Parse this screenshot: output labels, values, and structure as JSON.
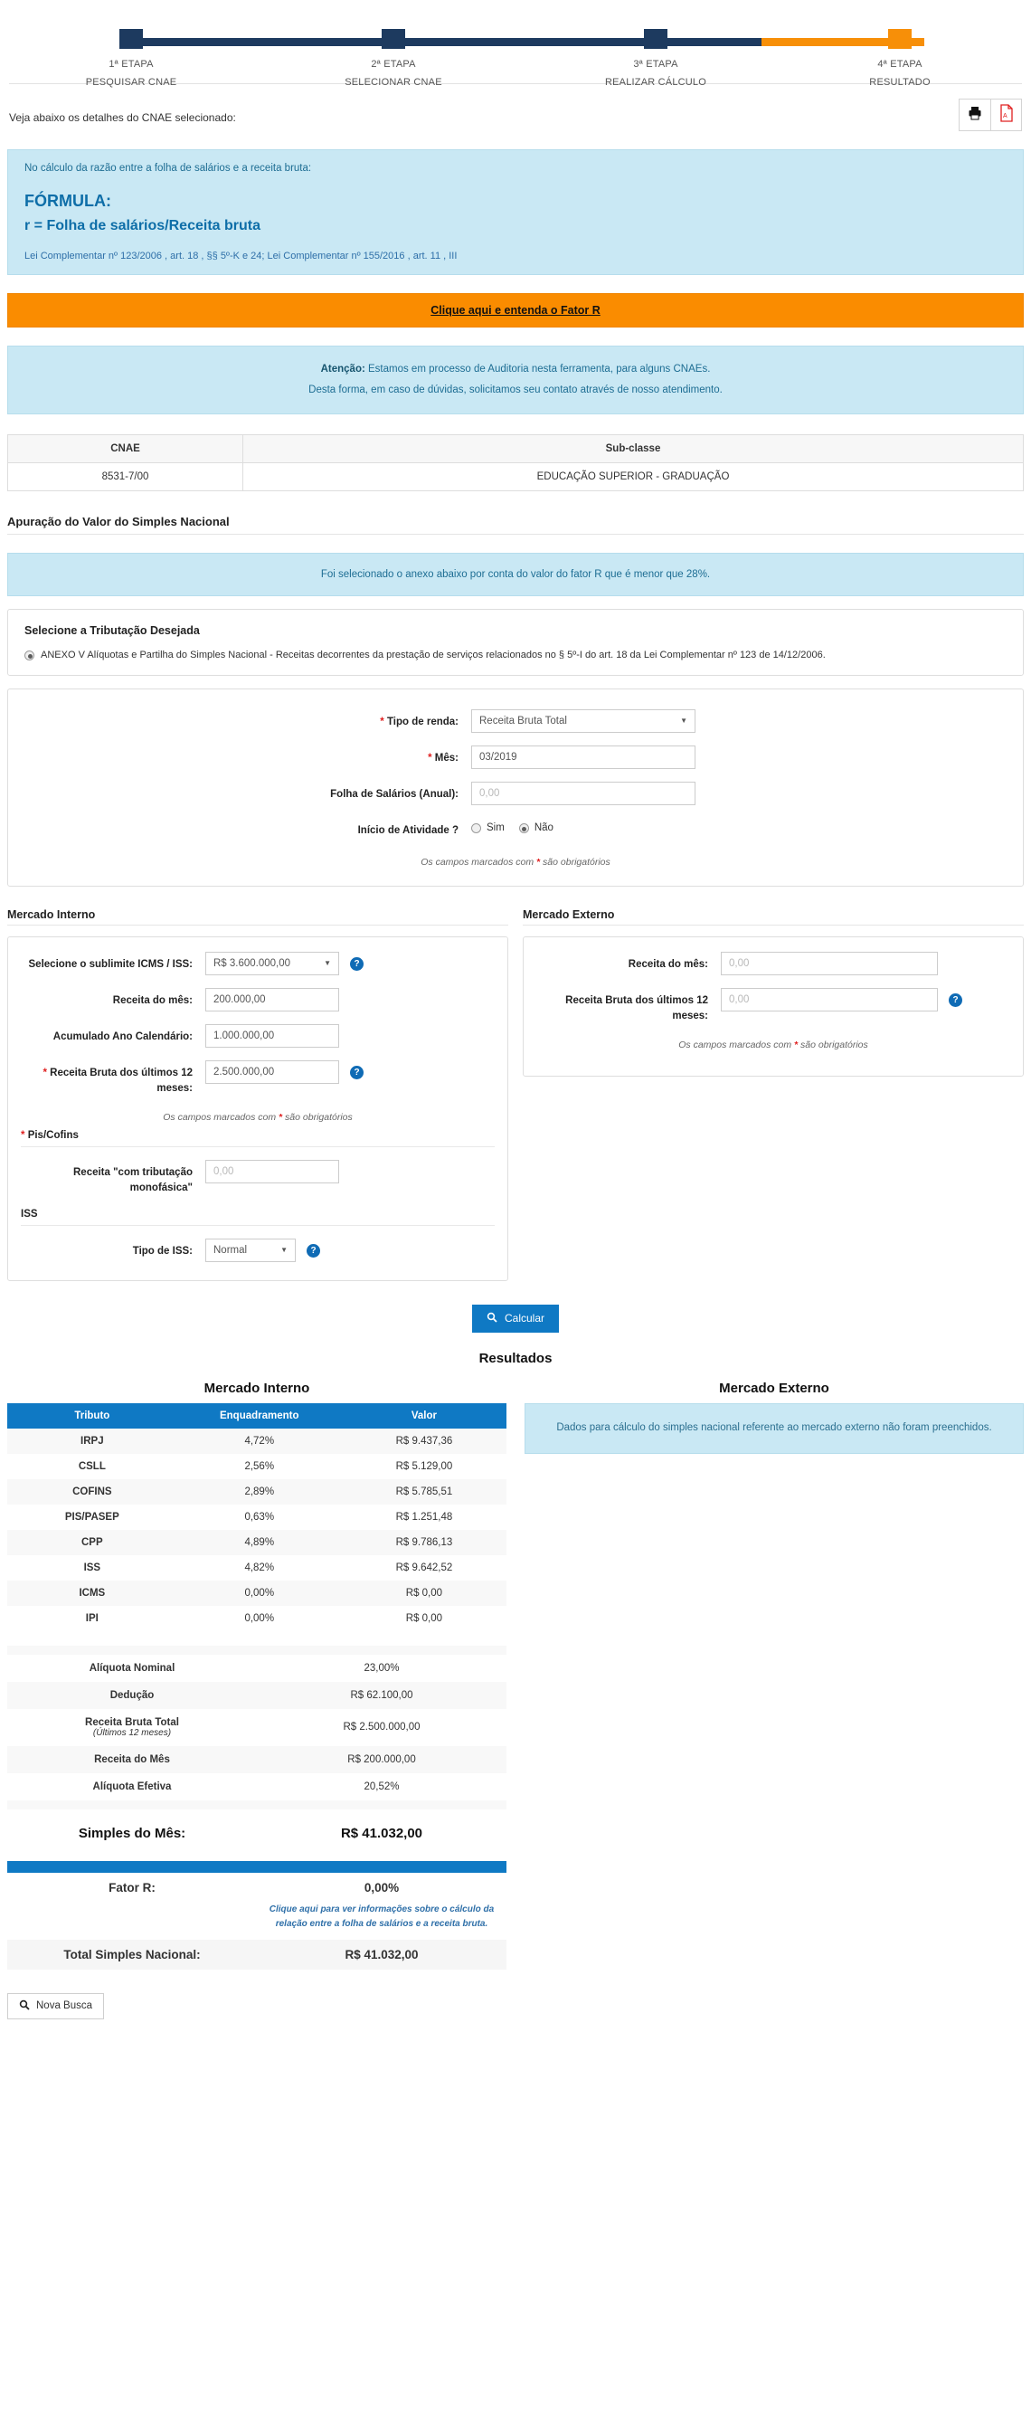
{
  "stepper": {
    "steps": [
      {
        "top": "1ª ETAPA",
        "bottom": "PESQUISAR CNAE"
      },
      {
        "top": "2ª ETAPA",
        "bottom": "SELECIONAR CNAE"
      },
      {
        "top": "3ª ETAPA",
        "bottom": "REALIZAR CÁLCULO"
      },
      {
        "top": "4ª ETAPA",
        "bottom": "RESULTADO"
      }
    ]
  },
  "topbar": {
    "lead": "Veja abaixo os detalhes do CNAE selecionado:",
    "print_icon": "printer-icon",
    "pdf_icon": "pdf-icon"
  },
  "formula_panel": {
    "intro": "No cálculo da razão entre a folha de salários e a receita bruta:",
    "title": "FÓRMULA:",
    "formula": "r = Folha de salários/Receita bruta",
    "law": "Lei Complementar nº 123/2006 , art. 18 , §§ 5º-K e 24; Lei Complementar nº 155/2016 , art. 11 , III"
  },
  "cta": {
    "label": "Clique aqui e entenda o Fator R"
  },
  "attention": {
    "prefix": "Atenção:",
    "line1": " Estamos em processo de Auditoria nesta ferramenta, para alguns CNAEs.",
    "line2": "Desta forma, em caso de dúvidas, solicitamos seu contato através de nosso atendimento."
  },
  "cnae_table": {
    "headers": [
      "CNAE",
      "Sub-classe"
    ],
    "row": {
      "cnae": "8531-7/00",
      "subclass": "EDUCAÇÃO SUPERIOR - GRADUAÇÃO"
    }
  },
  "apuracao": {
    "title": "Apuração do Valor do Simples Nacional",
    "notice": "Foi selecionado o anexo abaixo por conta do valor do fator R que é menor que 28%."
  },
  "tributacao": {
    "title": "Selecione a Tributação Desejada",
    "option": "ANEXO V Alíquotas e Partilha do Simples Nacional - Receitas decorrentes da prestação de serviços relacionados no § 5º-I do art. 18 da Lei Complementar nº 123 de 14/12/2006."
  },
  "main_form": {
    "tipo_renda_label": "Tipo de renda:",
    "tipo_renda_value": "Receita Bruta Total",
    "mes_label": "Mês:",
    "mes_value": "03/2019",
    "folha_label": "Folha de Salários (Anual):",
    "folha_placeholder": "0,00",
    "folha_value": "",
    "inicio_label": "Início de Atividade ?",
    "inicio_sim": "Sim",
    "inicio_nao": "Não",
    "inicio_selected": "Não",
    "required_note_pre": "Os campos marcados com ",
    "required_note_post": " são obrigatórios"
  },
  "mercado_interno": {
    "title": "Mercado Interno",
    "sublimite_label": "Selecione o sublimite ICMS / ISS:",
    "sublimite_value": "R$ 3.600.000,00",
    "receita_mes_label": "Receita do mês:",
    "receita_mes_value": "200.000,00",
    "acumulado_label": "Acumulado Ano Calendário:",
    "acumulado_value": "1.000.000,00",
    "rb12_label": "Receita Bruta dos últimos 12 meses:",
    "rb12_value": "2.500.000,00",
    "required_note_pre": "Os campos marcados com ",
    "required_note_post": " são obrigatórios",
    "piscofins_title": "Pis/Cofins",
    "monofasica_label": "Receita \"com tributação monofásica\"",
    "monofasica_placeholder": "0,00",
    "iss_title": "ISS",
    "tipo_iss_label": "Tipo de ISS:",
    "tipo_iss_value": "Normal"
  },
  "mercado_externo": {
    "title": "Mercado Externo",
    "receita_mes_label": "Receita do mês:",
    "receita_mes_placeholder": "0,00",
    "rb12_label": "Receita Bruta dos últimos 12 meses:",
    "rb12_placeholder": "0,00",
    "required_note_pre": "Os campos marcados com ",
    "required_note_post": " são obrigatórios"
  },
  "calcular": {
    "label": "Calcular",
    "icon": "search-icon"
  },
  "results": {
    "title": "Resultados",
    "interno_title": "Mercado Interno",
    "externo_title": "Mercado Externo",
    "externo_message": "Dados para cálculo do simples nacional referente ao mercado externo não foram preenchidos.",
    "headers": [
      "Tributo",
      "Enquadramento",
      "Valor"
    ],
    "rows": [
      {
        "tributo": "IRPJ",
        "enquadramento": "4,72%",
        "valor": "R$ 9.437,36"
      },
      {
        "tributo": "CSLL",
        "enquadramento": "2,56%",
        "valor": "R$ 5.129,00"
      },
      {
        "tributo": "COFINS",
        "enquadramento": "2,89%",
        "valor": "R$ 5.785,51"
      },
      {
        "tributo": "PIS/PASEP",
        "enquadramento": "0,63%",
        "valor": "R$ 1.251,48"
      },
      {
        "tributo": "CPP",
        "enquadramento": "4,89%",
        "valor": "R$ 9.786,13"
      },
      {
        "tributo": "ISS",
        "enquadramento": "4,82%",
        "valor": "R$ 9.642,52"
      },
      {
        "tributo": "ICMS",
        "enquadramento": "0,00%",
        "valor": "R$ 0,00"
      },
      {
        "tributo": "IPI",
        "enquadramento": "0,00%",
        "valor": "R$ 0,00"
      }
    ],
    "summary": [
      {
        "key": "Alíquota Nominal",
        "sub": "",
        "value": "23,00%"
      },
      {
        "key": "Dedução",
        "sub": "",
        "value": "R$ 62.100,00"
      },
      {
        "key": "Receita Bruta Total",
        "sub": "(Últimos 12 meses)",
        "value": "R$ 2.500.000,00"
      },
      {
        "key": "Receita do Mês",
        "sub": "",
        "value": "R$ 200.000,00"
      },
      {
        "key": "Alíquota Efetiva",
        "sub": "",
        "value": "20,52%"
      }
    ],
    "simples_mes_label": "Simples do Mês:",
    "simples_mes_value": "R$ 41.032,00",
    "fator_r_label": "Fator R:",
    "fator_r_value": "0,00%",
    "fator_r_note": "Clique aqui para ver informações sobre o cálculo da relação entre a folha de salários e a receita bruta.",
    "total_label": "Total Simples Nacional:",
    "total_value": "R$ 41.032,00"
  },
  "bottom": {
    "nova_busca": "Nova Busca",
    "icon": "search-icon"
  },
  "colors": {
    "navy": "#1d3a5f",
    "orange": "#fa8c00",
    "blue": "#0f79c4",
    "info_bg": "#c9e8f4",
    "required": "#e02020"
  }
}
